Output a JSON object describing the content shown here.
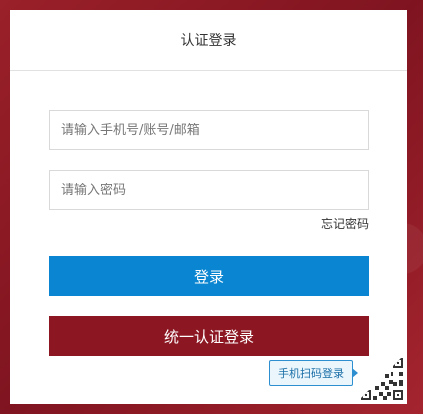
{
  "login": {
    "title": "认证登录",
    "account_placeholder": "请输入手机号/账号/邮箱",
    "password_placeholder": "请输入密码",
    "forgot_password": "忘记密码",
    "login_button": "登录",
    "unified_login_button": "统一认证登录",
    "qr_tip": "手机扫码登录"
  },
  "colors": {
    "login_button": "#0a85d1",
    "unified_button": "#8c1722",
    "background": "#8e1a24"
  }
}
